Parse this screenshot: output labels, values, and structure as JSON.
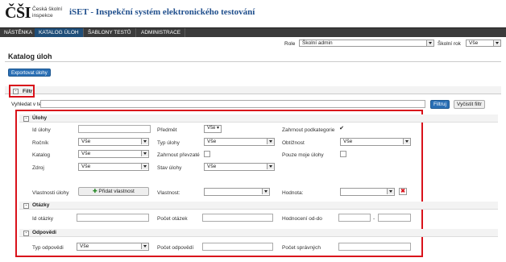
{
  "header": {
    "logo_mark": "ČŠI",
    "logo_text": "Česká školní inspekce",
    "app_title": "iSET - Inspekční systém elektronického testování"
  },
  "nav": [
    "NÁSTĚNKA",
    "KATALOG ÚLOH",
    "ŠABLONY TESTŮ",
    "ADMINISTRACE"
  ],
  "rolebar": {
    "role_label": "Role",
    "role_value": "Školní admin",
    "year_label": "Školní rok",
    "year_value": "Vše"
  },
  "page": {
    "title": "Katalog úloh",
    "export_label": "Exportovat úlohy"
  },
  "filter": {
    "toggle": "-",
    "title": "Filtr",
    "search_label": "Vyhledat v textu:",
    "search_value": "",
    "apply_label": "Filtruj",
    "clear_label": "Vyčistit filtr"
  },
  "ulohy": {
    "title": "Úlohy",
    "id_label": "Id úlohy",
    "predmet_label": "Předmět",
    "predmet_value": "Vše ▾",
    "zahrnout_pod_label": "Zahrnout podkategorie",
    "zahrnout_pod_mark": "✔",
    "rocnik_label": "Ročník",
    "rocnik_value": "Vše",
    "typ_label": "Typ úlohy",
    "typ_value": "Vše",
    "obtiznost_label": "Obtížnost",
    "obtiznost_value": "Vše",
    "katalog_label": "Katalog",
    "katalog_value": "Vše",
    "prevzate_label": "Zahrnout převzaté",
    "pouze_label": "Pouze moje úlohy",
    "zdroj_label": "Zdroj",
    "zdroj_value": "Vše",
    "stav_label": "Stav úlohy",
    "stav_value": "Vše",
    "vlastnosti_label": "Vlastnosti úlohy",
    "pridat_label": "Přidat vlastnost",
    "vlastnost_label": "Vlastnost:",
    "hodnota_label": "Hodnota:",
    "delete_mark": "✖"
  },
  "otazky": {
    "title": "Otázky",
    "id_label": "Id otázky",
    "pocet_label": "Počet otázek",
    "hodnoceni_label": "Hodnocení od-do",
    "dash": "-"
  },
  "odpovedi": {
    "title": "Odpovědi",
    "typ_label": "Typ odpovědi",
    "typ_value": "Vše",
    "pocet_label": "Počet odpovědí",
    "spravnych_label": "Počet správných"
  },
  "colors": {
    "nav_bg": "#3b3b3b",
    "nav_active": "#1f4e79",
    "title_blue": "#1f4e8c",
    "button_blue": "#2a6fb5",
    "highlight_red": "#d9121b"
  }
}
